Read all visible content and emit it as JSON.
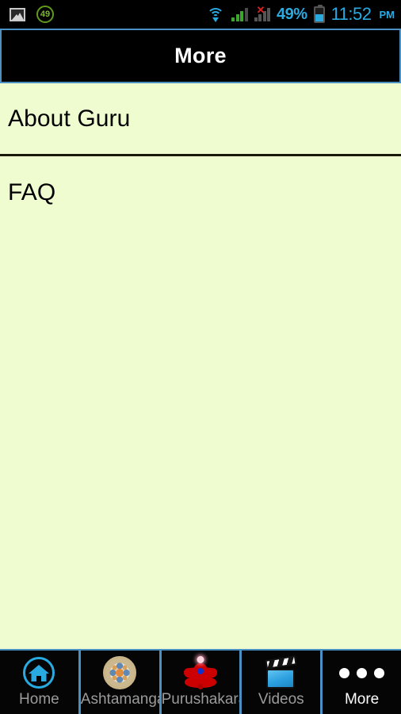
{
  "status_bar": {
    "gallery_icon": "gallery-icon",
    "notification_badge": "49",
    "wifi_icon": "wifi-icon",
    "signal_icon": "signal-bars-icon",
    "signal_no_service_icon": "signal-bars-error-icon",
    "battery_percent": "49%",
    "battery_level": 49,
    "battery_icon": "battery-icon",
    "time": "11:52",
    "ampm": "PM",
    "text_color": "#29ABE2"
  },
  "title_bar": {
    "title": "More",
    "background": "#000000",
    "border_color": "#4A90C2",
    "text_color": "#FFFFFF"
  },
  "content": {
    "background": "#EFFCD0",
    "items": [
      {
        "label": "About Guru"
      },
      {
        "label": "FAQ"
      }
    ]
  },
  "tab_bar": {
    "background": "#000000",
    "separator_color": "#4A90C2",
    "inactive_color": "#9B9B9B",
    "active_color": "#FFFFFF",
    "tabs": [
      {
        "label": "Home",
        "icon": "home-icon",
        "active": false
      },
      {
        "label": "Ashtamangala",
        "icon": "mandala-icon",
        "active": false
      },
      {
        "label": "Purushakara",
        "icon": "yoga-icon",
        "active": false
      },
      {
        "label": "Videos",
        "icon": "clapperboard-icon",
        "active": false
      },
      {
        "label": "More",
        "icon": "three-dots-icon",
        "active": true
      }
    ]
  }
}
